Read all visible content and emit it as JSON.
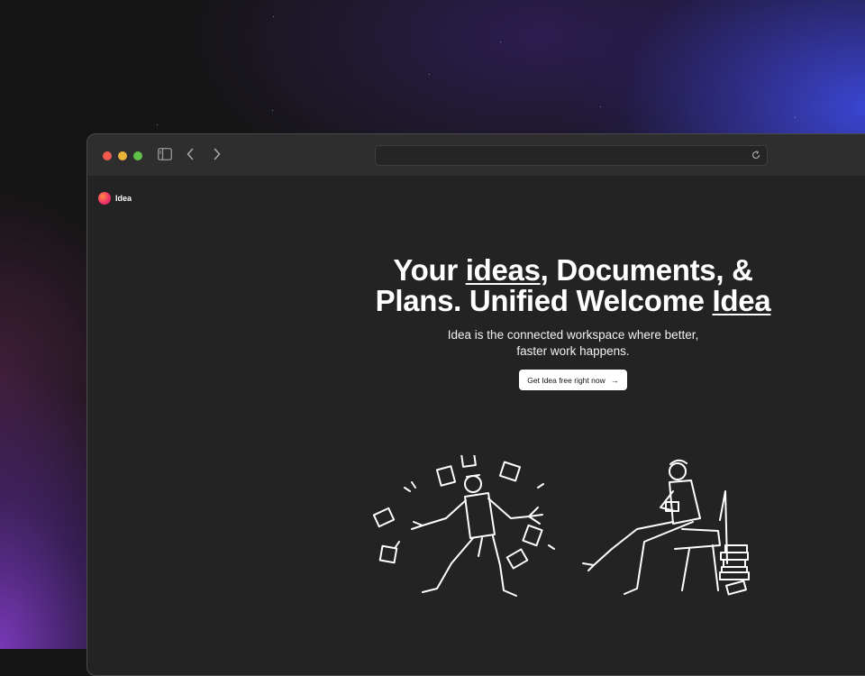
{
  "brand": {
    "name": "Idea"
  },
  "hero": {
    "title_part1": "Your ",
    "title_ideas": "ideas",
    "title_part2": ", Documents, & Plans. Unified Welcome ",
    "title_idea": "Idea",
    "subtitle": "Idea is the connected workspace where better, faster work happens.",
    "cta_label": "Get Idea free right now",
    "cta_icon": "arrow-right-icon"
  },
  "browser": {
    "address_value": "",
    "icons": [
      "sidebar-toggle-icon",
      "back-icon",
      "forward-icon",
      "reload-icon"
    ]
  },
  "colors": {
    "traffic_red": "#ef5a4f",
    "traffic_yellow": "#e8b73a",
    "traffic_green": "#5fc148",
    "page_bg": "#232323",
    "cta_bg": "#ffffff"
  }
}
